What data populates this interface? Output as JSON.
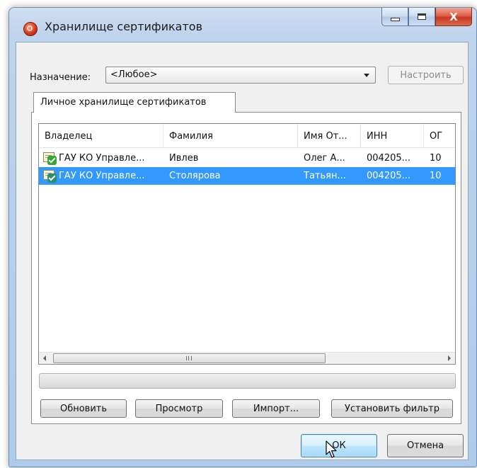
{
  "window": {
    "title": "Хранилище сертификатов",
    "close_glyph": "X"
  },
  "purpose": {
    "label": "Назначение:",
    "selected": "<Любое>"
  },
  "buttons": {
    "configure": "Настроить",
    "refresh": "Обновить",
    "view": "Просмотр",
    "import": "Импорт...",
    "set_filter": "Установить фильтр",
    "ok": "ОК",
    "cancel": "Отмена"
  },
  "tabs": [
    {
      "label": "Личное хранилище сертификатов"
    }
  ],
  "table": {
    "columns": [
      "Владелец",
      "Фамилия",
      "Имя От...",
      "ИНН",
      "ОГ"
    ],
    "rows": [
      {
        "owner": "ГАУ КО Управле...",
        "surname": "Ивлев",
        "name": "Олег А...",
        "inn": "004205...",
        "ogrn": "10",
        "selected": false
      },
      {
        "owner": "ГАУ КО Управле...",
        "surname": "Столярова",
        "name": "Татьян...",
        "inn": "004205...",
        "ogrn": "10",
        "selected": true
      }
    ],
    "scroll_grip": "III"
  },
  "progress": {
    "value": 0
  },
  "icons": {
    "app": "certificate-store-icon",
    "row": "certificate-check-icon",
    "cursor": "mouse-pointer-icon"
  },
  "colors": {
    "selection": "#3399ff",
    "title_bar": "#bed3ec",
    "close_button": "#c43b22"
  }
}
